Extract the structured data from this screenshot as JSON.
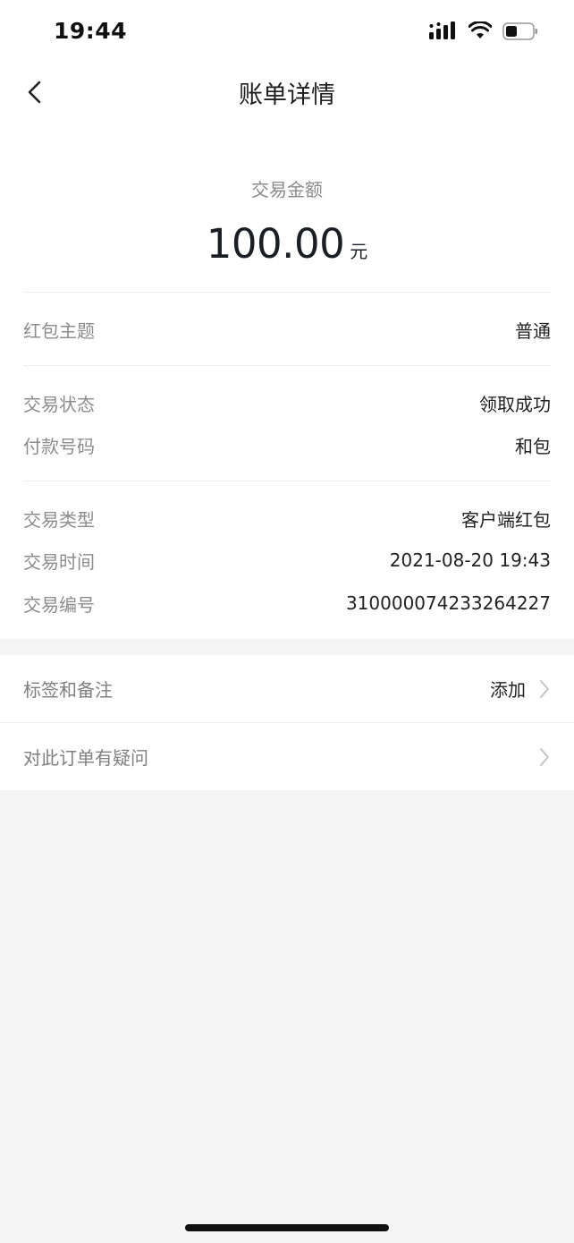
{
  "status_bar": {
    "time": "19:44",
    "icons": [
      "cellular-signal-icon",
      "wifi-icon",
      "battery-icon"
    ]
  },
  "nav": {
    "title": "账单详情",
    "back_icon": "chevron-left-icon"
  },
  "amount": {
    "label": "交易金额",
    "value": "100.00",
    "unit": "元"
  },
  "details": {
    "theme": {
      "label": "红包主题",
      "value": "普通"
    },
    "status": {
      "label": "交易状态",
      "value": "领取成功"
    },
    "payment": {
      "label": "付款号码",
      "value": "和包"
    },
    "type": {
      "label": "交易类型",
      "value": "客户端红包"
    },
    "time": {
      "label": "交易时间",
      "value": "2021-08-20 19:43"
    },
    "number": {
      "label": "交易编号",
      "value": "310000074233264227"
    }
  },
  "actions": {
    "tags": {
      "label": "标签和备注",
      "action": "添加"
    },
    "question": {
      "label": "对此订单有疑问"
    }
  },
  "colors": {
    "background": "#f5f5f5",
    "card": "#ffffff",
    "label": "#8c8c8c",
    "text": "#222222"
  }
}
